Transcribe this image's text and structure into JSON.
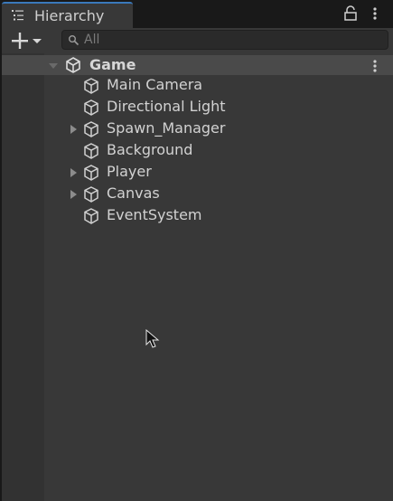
{
  "tab": {
    "title": "Hierarchy",
    "icon": "hierarchy-list-icon"
  },
  "header_buttons": {
    "lock": "lock-icon",
    "more": "kebab-menu-icon"
  },
  "toolbar": {
    "add": "plus-icon",
    "add_dropdown": "chevron-down-icon",
    "search_placeholder": "All"
  },
  "scene": {
    "name": "Game",
    "expanded": true,
    "icon": "unity-logo-icon"
  },
  "objects": [
    {
      "name": "Main Camera",
      "expandable": false
    },
    {
      "name": "Directional Light",
      "expandable": false
    },
    {
      "name": "Spawn_Manager",
      "expandable": true
    },
    {
      "name": "Background",
      "expandable": false
    },
    {
      "name": "Player",
      "expandable": true
    },
    {
      "name": "Canvas",
      "expandable": true
    },
    {
      "name": "EventSystem",
      "expandable": false
    }
  ],
  "colors": {
    "accent": "#3a79bb",
    "panel": "#383838",
    "scene_row": "#4a4a4a"
  }
}
